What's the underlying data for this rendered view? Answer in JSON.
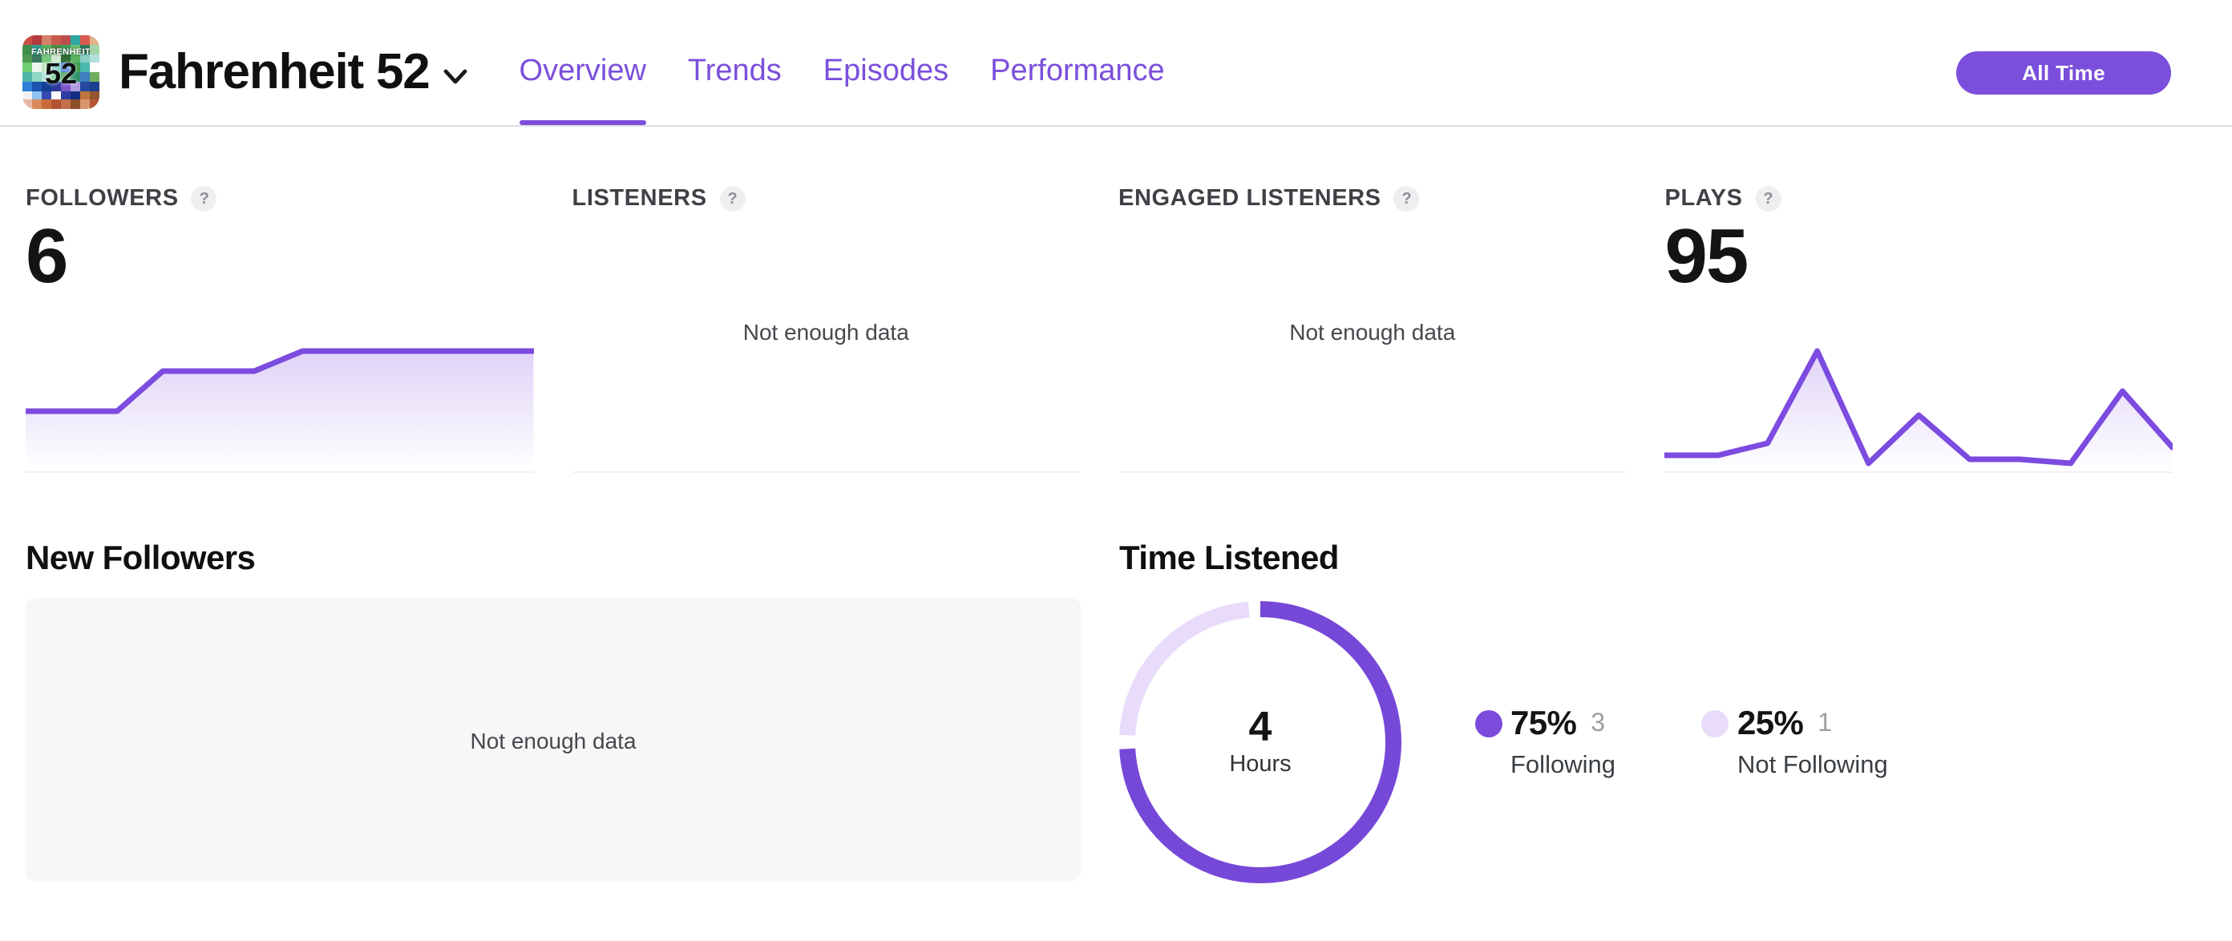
{
  "colors": {
    "accent": "#7B4FDC",
    "sparkline": "#7C4BDF",
    "donut_dark": "#7648D8",
    "donut_light": "#E8DCFA",
    "hairline": "#F1EFF6"
  },
  "header": {
    "show_title": "Fahrenheit 52",
    "logo": {
      "line1": "FAHRENHEIT",
      "line2": "52",
      "palette": [
        "#C94F43",
        "#B53A3F",
        "#D4806A",
        "#C75B49",
        "#BE4E4C",
        "#2FA6A0",
        "#D85B4E",
        "#E0B089",
        "#3E8F4C",
        "#2E9E8F",
        "#57B35F",
        "#4E8F47",
        "#3FA05C",
        "#6ABf72",
        "#2E7D5B",
        "#A5D6A7",
        "#4E9A52",
        "#39795D",
        "#77C77F",
        "#CFEAD2",
        "#2E6B33",
        "#57B35F",
        "#86CEC6",
        "#B2DFDB",
        "#6FCF74",
        "#EAF6EC",
        "#BFE6C4",
        "#80CBC4",
        "#5B8FD8",
        "#3F9E4E",
        "#49B8AE",
        "#CDEkDC",
        "#4FB6AA",
        "#8FD6C4",
        "#B7E3D9",
        "#6FC98E",
        "#59A96A",
        "#2F8F6B",
        "#3E7FBF",
        "#6FAF5E",
        "#2F7FD6",
        "#1C55B0",
        "#123F93",
        "#2C3B99",
        "#7C55C8",
        "#AF9BE0",
        "#26489E",
        "#1B3E8F",
        "#F2F2F2",
        "#8FC3F2",
        "#3A4BB0",
        "#FDFDFD",
        "#2B3C9E",
        "#122E80",
        "#C1763F",
        "#94552F",
        "#E8B9A2",
        "#D98A5B",
        "#C96B3B",
        "#B25433",
        "#C2714C",
        "#8D4E2A",
        "#D9956B",
        "#B3562F"
      ]
    },
    "tabs": [
      {
        "label": "Overview"
      },
      {
        "label": "Trends"
      },
      {
        "label": "Episodes"
      },
      {
        "label": "Performance"
      }
    ],
    "time_range_button": "All Time"
  },
  "stats": [
    {
      "label": "FOLLOWERS",
      "help": "?",
      "value": "6"
    },
    {
      "label": "LISTENERS",
      "help": "?",
      "empty_text": "Not enough data"
    },
    {
      "label": "ENGAGED LISTENERS",
      "help": "?",
      "empty_text": "Not enough data"
    },
    {
      "label": "PLAYS",
      "help": "?",
      "value": "95"
    }
  ],
  "sections": {
    "new_followers": {
      "title": "New Followers",
      "empty_text": "Not enough data"
    },
    "time_listened": {
      "title": "Time Listened",
      "center_value": "4",
      "center_label": "Hours",
      "legend": [
        {
          "percent": "75%",
          "count": "3",
          "label": "Following",
          "color": "#7B4CDB"
        },
        {
          "percent": "25%",
          "count": "1",
          "label": "Not Following",
          "color": "#E8DCFA"
        }
      ]
    }
  },
  "chart_data": [
    {
      "id": "followers_sparkline",
      "type": "area",
      "title": "Followers over time (all time)",
      "x_frac": [
        0,
        0.18,
        0.27,
        0.45,
        0.545,
        1.0
      ],
      "values": [
        3,
        3,
        5,
        5,
        6,
        6
      ],
      "ylim": [
        0,
        7.6
      ],
      "final_value": 6,
      "line_color": "#7C4BDF",
      "grid": false,
      "axes_hidden": true
    },
    {
      "id": "listeners",
      "type": "none",
      "note": "Not enough data"
    },
    {
      "id": "engaged_listeners",
      "type": "none",
      "note": "Not enough data"
    },
    {
      "id": "plays_sparkline",
      "type": "area",
      "title": "Plays over time (all time)",
      "x_frac": [
        0,
        0.106,
        0.203,
        0.301,
        0.402,
        0.501,
        0.601,
        0.699,
        0.8,
        0.902,
        1.0
      ],
      "values": [
        4,
        4,
        7,
        30,
        2,
        14,
        3,
        3,
        2,
        20,
        6
      ],
      "ylim": [
        0,
        38
      ],
      "total": 95,
      "line_color": "#7C4BDF",
      "grid": false,
      "axes_hidden": true
    },
    {
      "id": "time_listened_donut",
      "type": "pie",
      "title": "Time Listened",
      "center_value": "4",
      "center_label": "Hours",
      "slices": [
        {
          "label": "Following",
          "percent": 75,
          "count": 3,
          "color": "#7648D8"
        },
        {
          "label": "Not Following",
          "percent": 25,
          "count": 1,
          "color": "#E8DCFA"
        }
      ],
      "legend_position": "right"
    }
  ]
}
